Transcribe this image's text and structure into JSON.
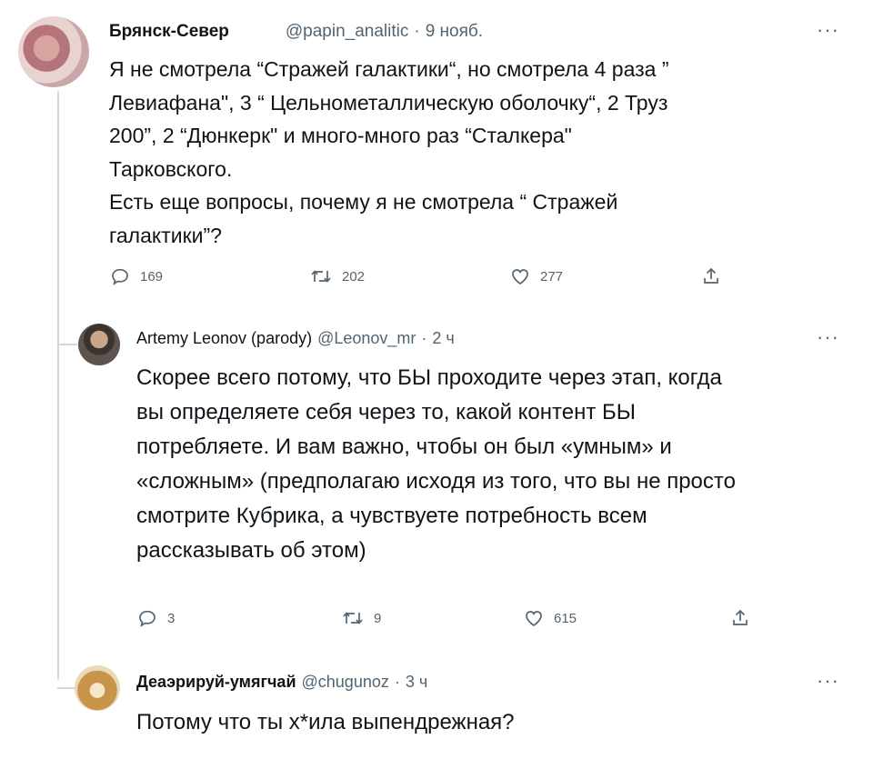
{
  "tweets": [
    {
      "name": "Брянск-Север",
      "handle": "@papin_analitic",
      "dot": "·",
      "time": "9 нояб.",
      "more": "···",
      "lines": [
        "Я не смотрела “Стражей галактики“, но смотрела 4 раза ”",
        "Левиафана\", 3 “ Цельнометаллическую оболочку“, 2 Труз",
        "200”, 2 “Дюнкерк\" и много-много раз “Сталкера\"",
        "Тарковского.",
        "Есть еще вопросы, почему я не смотрела “ Стражей",
        "галактики”?"
      ],
      "replies": "169",
      "retweets": "202",
      "likes": "277"
    },
    {
      "name": "Artemy Leonov (parody)",
      "handle": "@Leonov_mr",
      "dot": "·",
      "time": "2 ч",
      "more": "···",
      "lines": [
        "Скорее всего потому, что БЫ проходите через этап, когда",
        "вы определяете себя через то, какой контент БЫ",
        "потребляете. И вам важно, чтобы он был «умным» и",
        "«сложным» (предполагаю исходя из того, что вы не просто",
        "смотрите Кубрика, а чувствуете потребность всем",
        "рассказывать об этом)"
      ],
      "replies": "3",
      "retweets": "9",
      "likes": "615"
    },
    {
      "name": "Деаэрируй-умягчай",
      "handle": "@chugunoz",
      "dot": "·",
      "time": "3 ч",
      "more": "···",
      "lines": [
        "Потому что ты х*ила выпендрежная?"
      ]
    }
  ],
  "colors": {
    "text": "#0f1419",
    "secondary": "#536471",
    "line": "#cfd9de"
  },
  "icons": [
    "reply-icon",
    "retweet-icon",
    "like-icon",
    "share-icon",
    "more-icon"
  ]
}
